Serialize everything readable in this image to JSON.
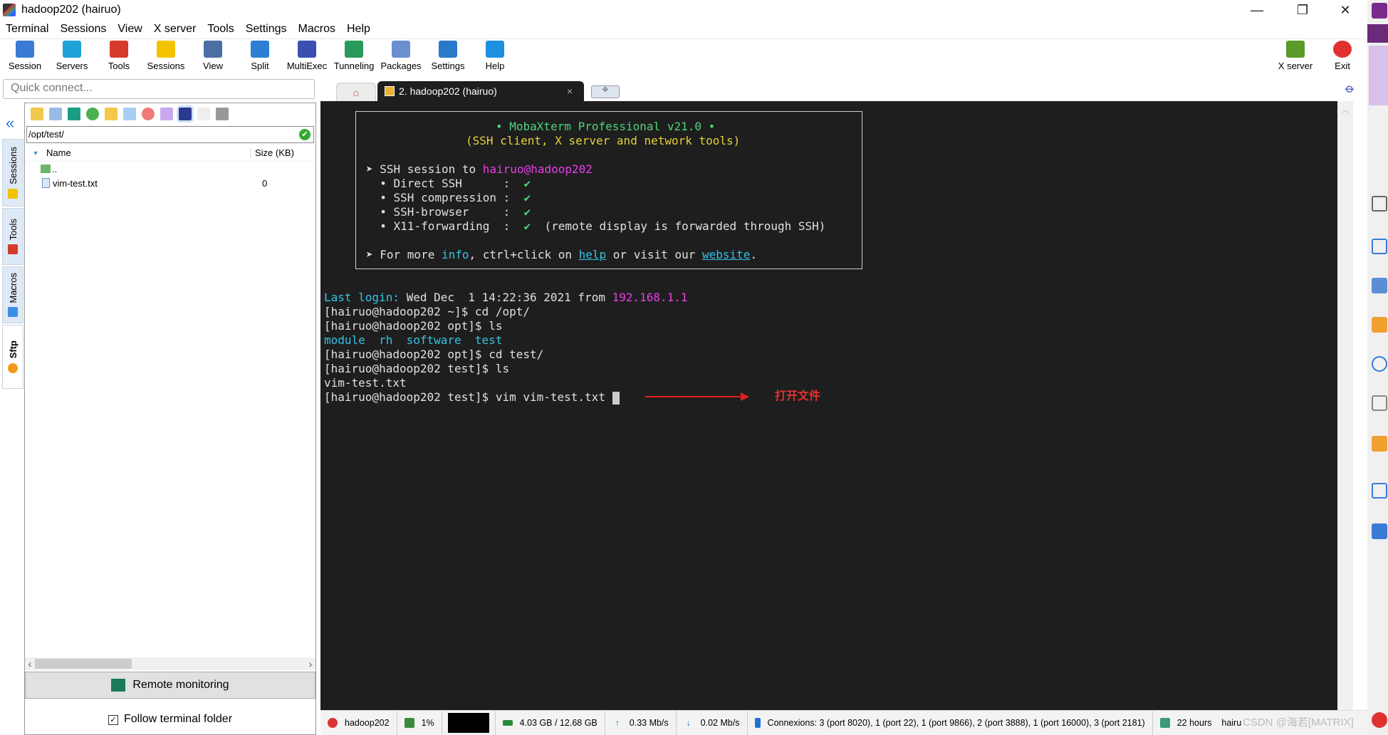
{
  "window": {
    "title": "hadoop202 (hairuo)",
    "minimize": "—",
    "maximize": "❐",
    "close": "✕"
  },
  "menu": [
    "Terminal",
    "Sessions",
    "View",
    "X server",
    "Tools",
    "Settings",
    "Macros",
    "Help"
  ],
  "toolbar": [
    {
      "label": "Session",
      "icon": "session-icon",
      "color": "#3a7bd5"
    },
    {
      "label": "Servers",
      "icon": "servers-icon",
      "color": "#1fa2d8"
    },
    {
      "label": "Tools",
      "icon": "tools-icon",
      "color": "#d63a2a"
    },
    {
      "label": "Sessions",
      "icon": "star-icon",
      "color": "#f3c300"
    },
    {
      "label": "View",
      "icon": "view-icon",
      "color": "#4a6fa5"
    },
    {
      "label": "Split",
      "icon": "split-icon",
      "color": "#2d7fd3"
    },
    {
      "label": "MultiExec",
      "icon": "multiexec-icon",
      "color": "#3a4fb0"
    },
    {
      "label": "Tunneling",
      "icon": "tunneling-icon",
      "color": "#2a9a5a"
    },
    {
      "label": "Packages",
      "icon": "packages-icon",
      "color": "#6c8fd0"
    },
    {
      "label": "Settings",
      "icon": "settings-icon",
      "color": "#2a78c8"
    },
    {
      "label": "Help",
      "icon": "help-icon",
      "color": "#1e90e0"
    }
  ],
  "toolbar_right": [
    {
      "label": "X server",
      "icon": "xserver-icon"
    },
    {
      "label": "Exit",
      "icon": "power-icon"
    }
  ],
  "quick_connect": {
    "placeholder": "Quick connect..."
  },
  "side_tabs": [
    {
      "label": "Sessions"
    },
    {
      "label": "Tools"
    },
    {
      "label": "Macros"
    },
    {
      "label": "Sftp"
    }
  ],
  "sftp": {
    "path": "/opt/test/",
    "columns": [
      "Name",
      "Size (KB)"
    ],
    "files": [
      {
        "name": "..",
        "size": ""
      },
      {
        "name": "vim-test.txt",
        "size": "0"
      }
    ],
    "remote_monitoring": "Remote monitoring",
    "follow_label": "Follow terminal folder",
    "follow_checked": true
  },
  "tabs": {
    "active": "2. hadoop202 (hairuo)",
    "close": "×"
  },
  "terminal": {
    "banner": {
      "title": "• MobaXterm Professional v21.0 •",
      "subtitle": "(SSH client, X server and network tools)",
      "session_prefix": "➤ SSH session to ",
      "session_target": "hairuo@hadoop202",
      "items": [
        {
          "label": "  • Direct SSH      :  ",
          "mark": "✔",
          "note": ""
        },
        {
          "label": "  • SSH compression :  ",
          "mark": "✔",
          "note": ""
        },
        {
          "label": "  • SSH-browser     :  ",
          "mark": "✔",
          "note": ""
        },
        {
          "label": "  • X11-forwarding  :  ",
          "mark": "✔",
          "note": "  (remote display is forwarded through SSH)"
        }
      ],
      "more_1": "➤ For more ",
      "more_info": "info",
      "more_2": ", ctrl+click on ",
      "more_help": "help",
      "more_3": " or visit our ",
      "more_web": "website",
      "more_4": "."
    },
    "last_login_label": "Last login:",
    "last_login_value": " Wed Dec  1 14:22:36 2021 from ",
    "last_login_ip": "192.168.1.1",
    "lines": [
      "[hairuo@hadoop202 ~]$ cd /opt/",
      "[hairuo@hadoop202 opt]$ ls"
    ],
    "ls_output": "module  rh  software  test",
    "lines2": [
      "[hairuo@hadoop202 opt]$ cd test/",
      "[hairuo@hadoop202 test]$ ls",
      "vim-test.txt"
    ],
    "prompt_last": "[hairuo@hadoop202 test]$ vim vim-test.txt ",
    "annotation": "打开文件"
  },
  "status": {
    "host": "hadoop202",
    "cpu": "1%",
    "memory": "4.03 GB / 12.68 GB",
    "upload": "0.33 Mb/s",
    "download": "0.02 Mb/s",
    "connexions": "Connexions: 3 (port 8020), 1 (port 22), 1 (port 9866), 2 (port 3888), 1 (port 16000), 3 (port 2181)",
    "uptime": "22 hours",
    "user": "hairu",
    "watermark": "CSDN @海若[MATRIX]"
  }
}
